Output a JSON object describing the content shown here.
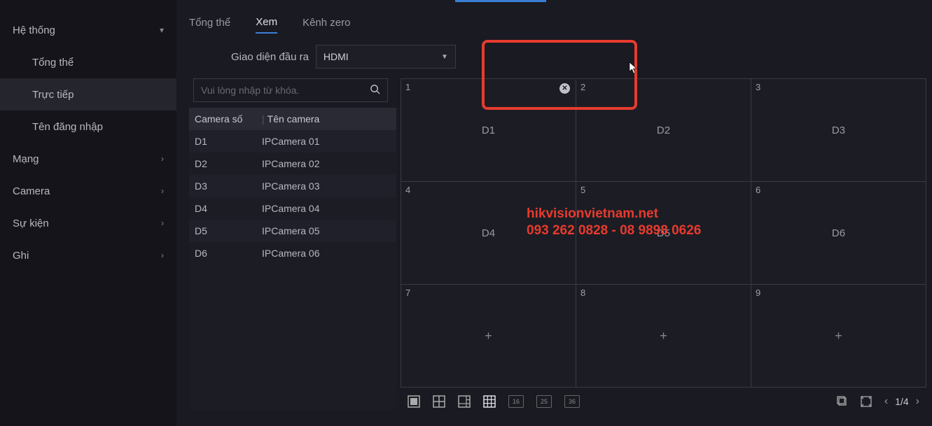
{
  "sidebar": {
    "items": [
      {
        "label": "Hệ thống",
        "type": "group",
        "expanded": true
      },
      {
        "label": "Tổng thể",
        "type": "sub"
      },
      {
        "label": "Trực tiếp",
        "type": "sub",
        "active": true
      },
      {
        "label": "Tên đăng nhập",
        "type": "sub"
      },
      {
        "label": "Mạng",
        "type": "group"
      },
      {
        "label": "Camera",
        "type": "group"
      },
      {
        "label": "Sự kiện",
        "type": "group"
      },
      {
        "label": "Ghi",
        "type": "group"
      }
    ]
  },
  "tabs": [
    {
      "label": "Tổng thể"
    },
    {
      "label": "Xem",
      "active": true
    },
    {
      "label": "Kênh zero"
    }
  ],
  "output": {
    "label": "Giao diện đầu ra",
    "value": "HDMI"
  },
  "search": {
    "placeholder": "Vui lòng nhập từ khóa."
  },
  "cam_table": {
    "headers": {
      "col1": "Camera số",
      "col2": "Tên camera"
    },
    "rows": [
      {
        "id": "D1",
        "name": "IPCamera 01"
      },
      {
        "id": "D2",
        "name": "IPCamera 02"
      },
      {
        "id": "D3",
        "name": "IPCamera 03"
      },
      {
        "id": "D4",
        "name": "IPCamera 04"
      },
      {
        "id": "D5",
        "name": "IPCamera 05"
      },
      {
        "id": "D6",
        "name": "IPCamera 06"
      }
    ]
  },
  "grid": {
    "cells": [
      {
        "num": "1",
        "label": "D1",
        "closable": true
      },
      {
        "num": "2",
        "label": "D2"
      },
      {
        "num": "3",
        "label": "D3"
      },
      {
        "num": "4",
        "label": "D4"
      },
      {
        "num": "5",
        "label": "D5"
      },
      {
        "num": "6",
        "label": "D6"
      },
      {
        "num": "7",
        "label": "+",
        "empty": true
      },
      {
        "num": "8",
        "label": "+",
        "empty": true
      },
      {
        "num": "9",
        "label": "+",
        "empty": true
      }
    ]
  },
  "toolbar": {
    "layouts_num": [
      "16",
      "25",
      "36"
    ],
    "page": "1/4"
  },
  "watermark": {
    "line1": "hikvisionvietnam.net",
    "line2": "093 262 0828 - 08 9898 0626"
  }
}
